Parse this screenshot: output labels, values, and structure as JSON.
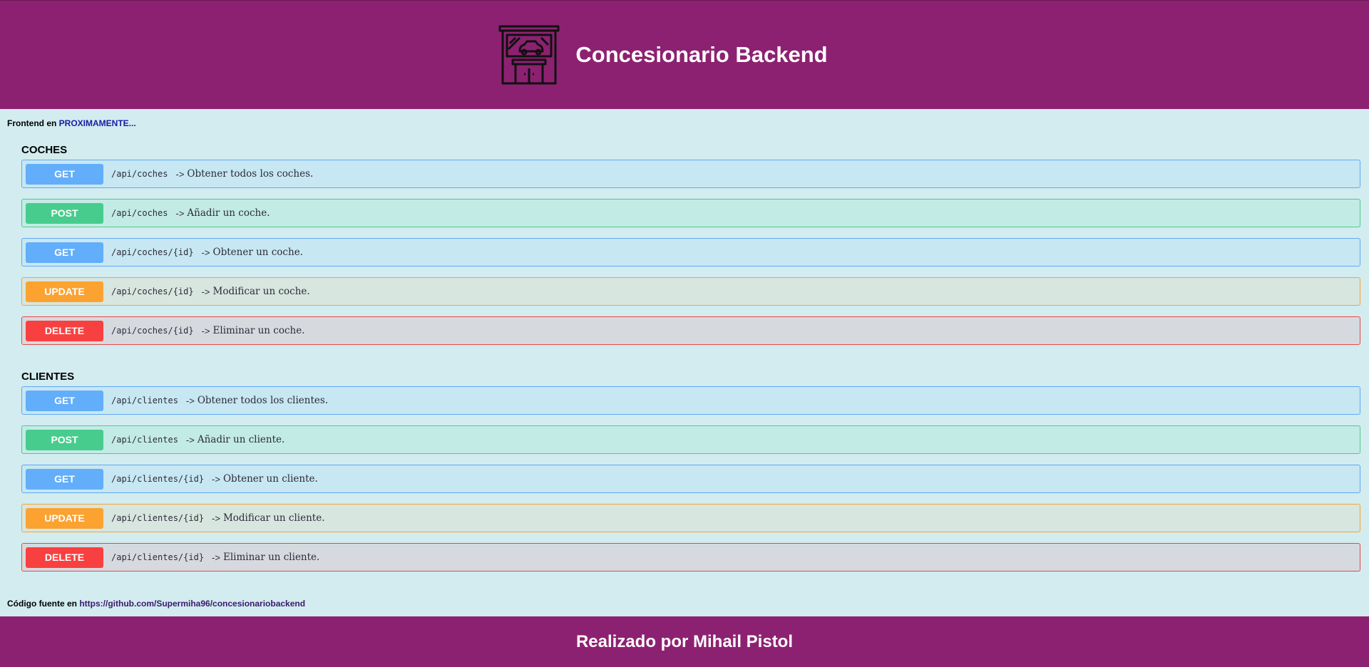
{
  "header": {
    "title": "Concesionario Backend",
    "logo_icon": "car-dealership-icon"
  },
  "frontend": {
    "prefix": "Frontend en",
    "link_text": "PROXIMAMENTE..."
  },
  "sections": [
    {
      "title": "COCHES",
      "endpoints": [
        {
          "method": "GET",
          "path": "/api/coches",
          "arrow": "->",
          "desc": "Obtener todos los coches."
        },
        {
          "method": "POST",
          "path": "/api/coches",
          "arrow": "->",
          "desc": "Añadir un coche."
        },
        {
          "method": "GET",
          "path": "/api/coches/{id}",
          "arrow": "->",
          "desc": "Obtener un coche."
        },
        {
          "method": "UPDATE",
          "path": "/api/coches/{id}",
          "arrow": "->",
          "desc": "Modificar un coche."
        },
        {
          "method": "DELETE",
          "path": "/api/coches/{id}",
          "arrow": "->",
          "desc": "Eliminar un coche."
        }
      ]
    },
    {
      "title": "CLIENTES",
      "endpoints": [
        {
          "method": "GET",
          "path": "/api/clientes",
          "arrow": "->",
          "desc": "Obtener todos los clientes."
        },
        {
          "method": "POST",
          "path": "/api/clientes",
          "arrow": "->",
          "desc": "Añadir un cliente."
        },
        {
          "method": "GET",
          "path": "/api/clientes/{id}",
          "arrow": "->",
          "desc": "Obtener un cliente."
        },
        {
          "method": "UPDATE",
          "path": "/api/clientes/{id}",
          "arrow": "->",
          "desc": "Modificar un cliente."
        },
        {
          "method": "DELETE",
          "path": "/api/clientes/{id}",
          "arrow": "->",
          "desc": "Eliminar un cliente."
        }
      ]
    }
  ],
  "source": {
    "prefix": "Código fuente en",
    "link_text": "https://github.com/Supermiha96/concesionariobackend"
  },
  "footer": {
    "credit": "Realizado por Mihail Pistol"
  },
  "colors": {
    "header_bg": "#8d2171",
    "page_bg": "#d2ecef",
    "get": "#62aefb",
    "post": "#47cc8e",
    "update": "#fba231",
    "delete": "#f94040"
  }
}
